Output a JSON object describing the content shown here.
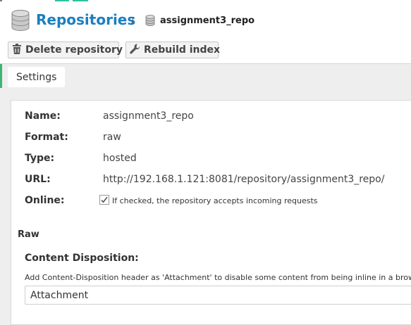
{
  "header": {
    "title": "Repositories",
    "separator": "/",
    "breadcrumb": "assignment3_repo",
    "icons": {
      "title_icon": "database-icon",
      "breadcrumb_icon": "database-icon"
    }
  },
  "toolbar": {
    "delete_label": "Delete repository",
    "delete_icon": "trash-icon",
    "rebuild_label": "Rebuild index",
    "rebuild_icon": "wrench-icon"
  },
  "tabs": [
    {
      "label": "Settings",
      "active": true
    }
  ],
  "details": {
    "name_label": "Name:",
    "name_value": "assignment3_repo",
    "format_label": "Format:",
    "format_value": "raw",
    "type_label": "Type:",
    "type_value": "hosted",
    "url_label": "URL:",
    "url_value": "http://192.168.1.121:8081/repository/assignment3_repo/",
    "online_label": "Online:",
    "online_checked": true,
    "online_hint": "If checked, the repository accepts incoming requests"
  },
  "raw_section": {
    "title": "Raw",
    "content_disposition_label": "Content Disposition:",
    "content_disposition_help": "Add Content-Disposition header as 'Attachment' to disable some content from being inline in a browser.",
    "content_disposition_value": "Attachment"
  },
  "colors": {
    "title_blue": "#1a7fc1",
    "accent_green": "#3bb573",
    "panel_bg": "#ffffff",
    "page_bg": "#eeeeee"
  }
}
